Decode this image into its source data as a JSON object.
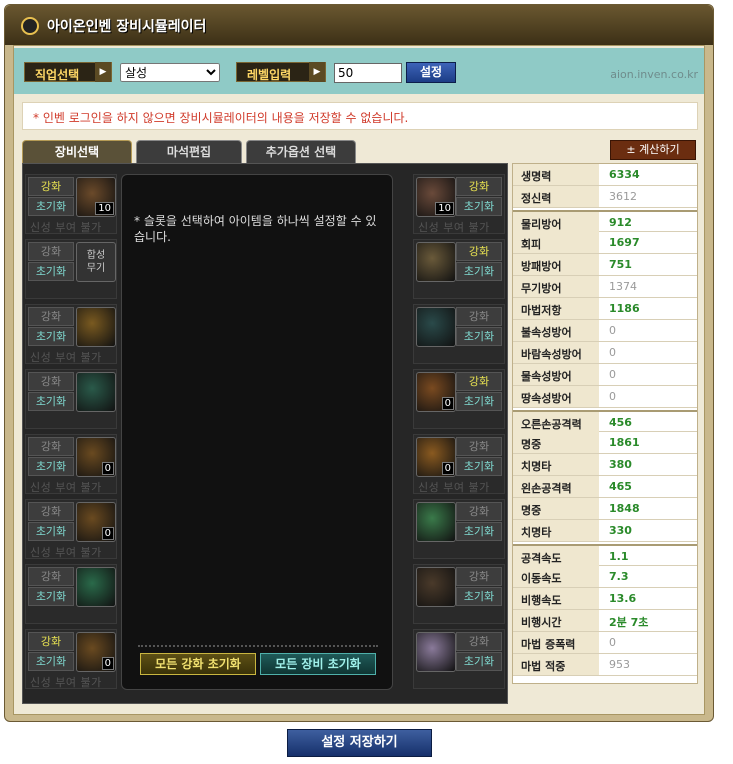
{
  "title": "아이온인벤 장비시뮬레이터",
  "controls": {
    "job_label": "직업선택",
    "job_value": "살성",
    "level_label": "레벨입력",
    "level_value": "50",
    "set_label": "설정",
    "site": "aion.inven.co.kr"
  },
  "notice": "* 인벤 로그인을 하지 않으면 장비시뮬레이터의 내용을 저장할 수 없습니다.",
  "tabs": [
    "장비선택",
    "마석편집",
    "추가옵션 선택"
  ],
  "calc_label": "± 계산하기",
  "slot_labels": {
    "enhance": "강화",
    "reset": "초기화",
    "no_imbue": "신성 부여 불가",
    "composite": "합성무기"
  },
  "left_slots": [
    {
      "enh_active": true,
      "num": "10",
      "no_imbue": true,
      "icon_color": "#6b4a2a",
      "icon": "sword-icon"
    },
    {
      "enh_active": false,
      "num": "",
      "no_imbue": false,
      "composite": true,
      "icon_color": "#3a3a3a",
      "icon": "composite-weapon-icon"
    },
    {
      "enh_active": false,
      "num": "",
      "no_imbue": true,
      "icon_color": "#7a5a20",
      "icon": "helmet-icon"
    },
    {
      "enh_active": false,
      "num": "",
      "no_imbue": false,
      "icon_color": "#2a5a4a",
      "icon": "necklace-icon"
    },
    {
      "enh_active": false,
      "num": "0",
      "no_imbue": true,
      "icon_color": "#6a4a20",
      "icon": "chest-armor-icon"
    },
    {
      "enh_active": false,
      "num": "0",
      "no_imbue": true,
      "icon_color": "#6a4a20",
      "icon": "gloves-icon"
    },
    {
      "enh_active": false,
      "num": "",
      "no_imbue": false,
      "icon_color": "#2a6a4a",
      "icon": "ring-icon"
    },
    {
      "enh_active": true,
      "num": "0",
      "no_imbue": true,
      "icon_color": "#6a4a20",
      "icon": "pants-icon"
    }
  ],
  "right_slots": [
    {
      "enh_active": true,
      "num": "10",
      "no_imbue": true,
      "icon_color": "#6a4a3a",
      "icon": "offhand-sword-icon"
    },
    {
      "enh_active": true,
      "num": "",
      "no_imbue": false,
      "icon_color": "#6a5a3a",
      "icon": "earring-icon"
    },
    {
      "enh_active": false,
      "num": "",
      "no_imbue": false,
      "icon_color": "#2a4a4a",
      "icon": "earring2-icon"
    },
    {
      "enh_active": true,
      "num": "0",
      "no_imbue": false,
      "icon_color": "#7a4a20",
      "icon": "shoulder-icon"
    },
    {
      "enh_active": false,
      "num": "0",
      "no_imbue": true,
      "icon_color": "#8a5a20",
      "icon": "boots-icon"
    },
    {
      "enh_active": false,
      "num": "",
      "no_imbue": false,
      "icon_color": "#3a7a4a",
      "icon": "ring2-icon"
    },
    {
      "enh_active": false,
      "num": "",
      "no_imbue": false,
      "icon_color": "#4a3a2a",
      "icon": "belt-icon"
    },
    {
      "enh_active": false,
      "num": "",
      "no_imbue": false,
      "icon_color": "#8a7a9a",
      "icon": "wings-icon"
    }
  ],
  "center": {
    "message": "* 슬롯을 선택하여 아이템을 하나씩 설정할 수 있습니다.",
    "reset_enh": "모든 강화 초기화",
    "reset_eq": "모든 장비 초기화"
  },
  "stats": [
    {
      "k": "생명력",
      "v": "6334",
      "g": true
    },
    {
      "k": "정신력",
      "v": "3612",
      "g": false
    },
    {
      "k": "물리방어",
      "v": "912",
      "g": true,
      "sep": true
    },
    {
      "k": "회피",
      "v": "1697",
      "g": true
    },
    {
      "k": "방패방어",
      "v": "751",
      "g": true
    },
    {
      "k": "무기방어",
      "v": "1374",
      "g": false
    },
    {
      "k": "마법저항",
      "v": "1186",
      "g": true
    },
    {
      "k": "불속성방어",
      "v": "0",
      "g": false
    },
    {
      "k": "바람속성방어",
      "v": "0",
      "g": false
    },
    {
      "k": "물속성방어",
      "v": "0",
      "g": false
    },
    {
      "k": "땅속성방어",
      "v": "0",
      "g": false
    },
    {
      "k": "오른손공격력",
      "v": "456",
      "g": true,
      "sep": true
    },
    {
      "k": "명중",
      "v": "1861",
      "g": true
    },
    {
      "k": "치명타",
      "v": "380",
      "g": true
    },
    {
      "k": "왼손공격력",
      "v": "465",
      "g": true
    },
    {
      "k": "명중",
      "v": "1848",
      "g": true
    },
    {
      "k": "치명타",
      "v": "330",
      "g": true
    },
    {
      "k": "공격속도",
      "v": "1.1",
      "g": true,
      "sep": true
    },
    {
      "k": "이동속도",
      "v": "7.3",
      "g": true
    },
    {
      "k": "비행속도",
      "v": "13.6",
      "g": true
    },
    {
      "k": "비행시간",
      "v": "2분 7초",
      "g": true
    },
    {
      "k": "마법 증폭력",
      "v": "0",
      "g": false
    },
    {
      "k": "마법 적중",
      "v": "953",
      "g": false
    }
  ],
  "save_label": "설정 저장하기"
}
